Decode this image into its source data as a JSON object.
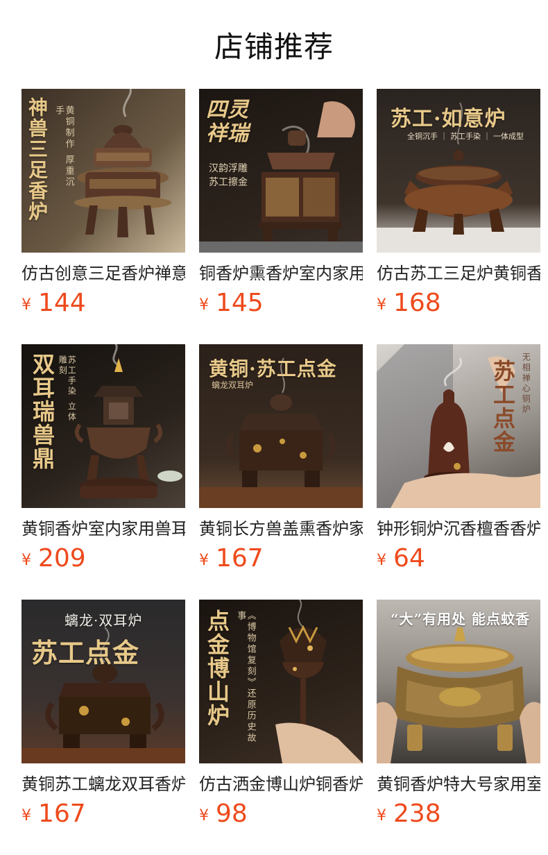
{
  "header": {
    "title": "店铺推荐"
  },
  "currency_symbol": "¥",
  "products": [
    {
      "name": "仿古创意三足香炉禅意",
      "price": "144",
      "image_text": {
        "main": "神兽三足香炉",
        "sub": "黄铜制作 厚重沉手"
      },
      "icon": "incense-burner-three-legged"
    },
    {
      "name": "铜香炉熏香炉室内家用",
      "price": "145",
      "image_text": {
        "main": "四灵祥瑞",
        "sub1": "汉韵浮雕",
        "sub2": "苏工擦金"
      },
      "icon": "incense-burner-square"
    },
    {
      "name": "仿古苏工三足炉黄铜香",
      "price": "168",
      "image_text": {
        "main": "苏工·如意炉",
        "sub": "全铜沉手 ｜ 苏工手染 ｜ 一体成型"
      },
      "icon": "incense-burner-round"
    },
    {
      "name": "黄铜香炉室内家用兽耳",
      "price": "209",
      "image_text": {
        "main": "双耳瑞兽鼎",
        "sub": "苏工手染 立体雕刻"
      },
      "icon": "incense-burner-pagoda"
    },
    {
      "name": "黄铜长方兽盖熏香炉家",
      "price": "167",
      "image_text": {
        "main": "黄铜·苏工点金",
        "sub": "螭龙双耳炉"
      },
      "icon": "incense-burner-beast-lid"
    },
    {
      "name": "钟形铜炉沉香檀香香炉",
      "price": "64",
      "image_text": {
        "main": "苏工点金",
        "sub": "无相禅心铜炉"
      },
      "icon": "incense-burner-bell"
    },
    {
      "name": "黄铜苏工螭龙双耳香炉",
      "price": "167",
      "image_text": {
        "main": "苏工点金",
        "sub": "螭龙·双耳炉"
      },
      "icon": "incense-burner-dragon"
    },
    {
      "name": "仿古洒金博山炉铜香炉",
      "price": "98",
      "image_text": {
        "main": "点金博山炉",
        "sub": "《博物馆复刻》还原历史故事"
      },
      "icon": "incense-burner-boshan"
    },
    {
      "name": "黄铜香炉特大号家用室",
      "price": "238",
      "image_text": {
        "main": "“大”有用处 能点蚊香"
      },
      "icon": "incense-burner-large"
    }
  ],
  "colors": {
    "price": "#ee4a1c",
    "title": "#111111",
    "gold_text": "#e8c98a"
  }
}
